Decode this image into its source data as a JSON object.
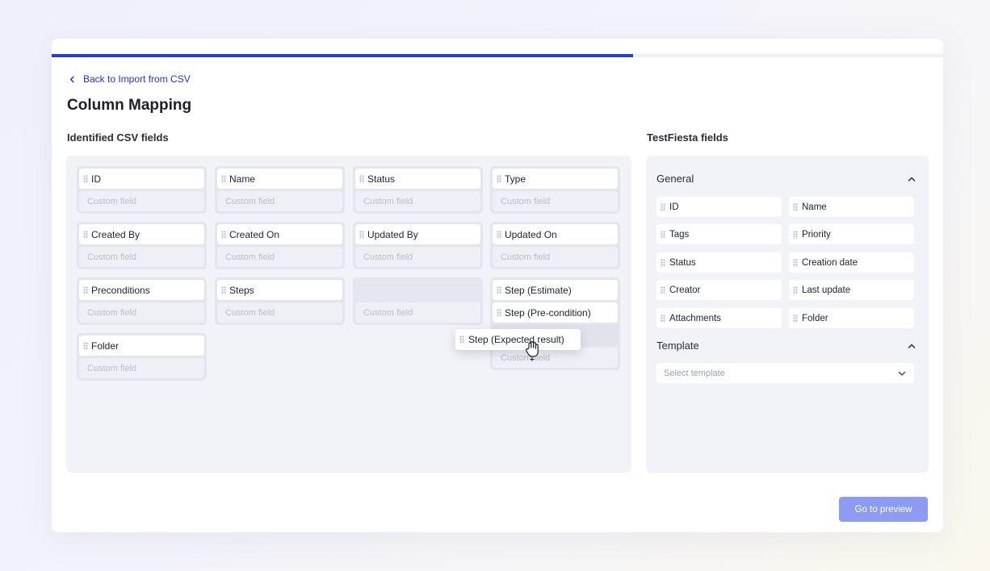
{
  "progress": {
    "fraction": 0.652
  },
  "back_link": {
    "label": "Back to Import from CSV",
    "icon": "chevron-left-icon"
  },
  "page_title": "Column Mapping",
  "csv_section": {
    "title": "Identified CSV fields",
    "custom_placeholder": "Custom field",
    "cards": [
      {
        "name": "ID"
      },
      {
        "name": "Name"
      },
      {
        "name": "Status"
      },
      {
        "name": "Type"
      },
      {
        "name": "Created By"
      },
      {
        "name": "Created On"
      },
      {
        "name": "Updated By"
      },
      {
        "name": "Updated On"
      },
      {
        "name": "Preconditions"
      },
      {
        "name": "Steps"
      },
      {
        "name": ""
      },
      {
        "name": "Step (Estimate)",
        "stacked": [
          "Step (Pre-condition)"
        ]
      },
      {
        "name": "Folder"
      }
    ],
    "dragging": {
      "label": "Step (Expected result)"
    },
    "partially_hidden_placeholder": "Custom field"
  },
  "testfiesta_section": {
    "title": "TestFiesta fields",
    "general": {
      "title": "General",
      "fields": [
        "ID",
        "Name",
        "Tags",
        "Priority",
        "Status",
        "Creation date",
        "Creator",
        "Last update",
        "Attachments",
        "Folder"
      ]
    },
    "template": {
      "title": "Template",
      "select_placeholder": "Select template"
    }
  },
  "cta": {
    "label": "Go to preview"
  },
  "colors": {
    "accent": "#1f3fd8",
    "link": "#1f36c9",
    "cta_disabled": "#8d9bf2"
  }
}
